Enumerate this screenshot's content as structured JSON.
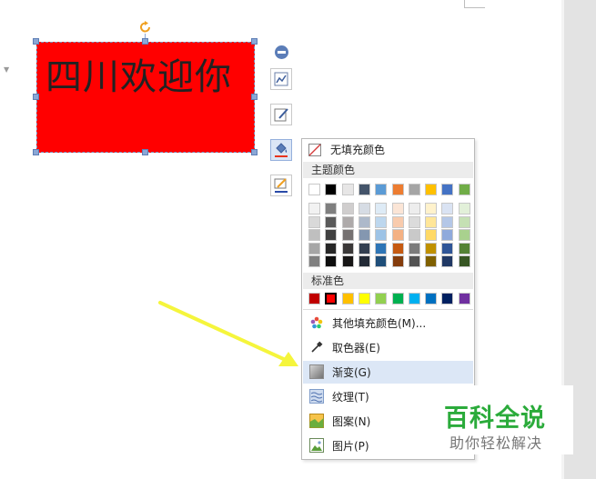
{
  "textbox": {
    "text": "四川欢迎你",
    "fill": "#ff0000"
  },
  "side_tools": [
    {
      "name": "collapse",
      "icon": "minus-circle-icon"
    },
    {
      "name": "chart-layout",
      "icon": "chart-icon"
    },
    {
      "name": "edit-shape",
      "icon": "shape-edit-icon"
    },
    {
      "name": "fill",
      "icon": "paint-bucket-icon"
    },
    {
      "name": "outline",
      "icon": "outline-pen-icon"
    }
  ],
  "fill_menu": {
    "no_fill": "无填充颜色",
    "theme_colors_title": "主题颜色",
    "theme_top_row": [
      "#ffffff",
      "#000000",
      "#e7e6e6",
      "#44546a",
      "#5b9bd5",
      "#ed7d31",
      "#a5a5a5",
      "#ffc000",
      "#4472c4",
      "#70ad47"
    ],
    "theme_shades": [
      [
        "#f2f2f2",
        "#7f7f7f",
        "#d0cece",
        "#d6dce4",
        "#deebf6",
        "#fbe5d6",
        "#ededed",
        "#fff2cc",
        "#dae3f3",
        "#e2f0d9"
      ],
      [
        "#d9d9d9",
        "#595959",
        "#aeaaaa",
        "#adb9ca",
        "#bdd7ee",
        "#f8cbad",
        "#dbdbdb",
        "#ffe699",
        "#b4c7e7",
        "#c5e0b4"
      ],
      [
        "#bfbfbf",
        "#404040",
        "#757171",
        "#8497b0",
        "#9dc3e6",
        "#f4b183",
        "#c9c9c9",
        "#ffd966",
        "#8faadc",
        "#a9d18e"
      ],
      [
        "#a6a6a6",
        "#262626",
        "#3a3838",
        "#333f50",
        "#2e75b6",
        "#c55a11",
        "#7b7b7b",
        "#bf9000",
        "#2f5597",
        "#548235"
      ],
      [
        "#808080",
        "#0d0d0d",
        "#171616",
        "#222a35",
        "#1f4e79",
        "#843c0c",
        "#525252",
        "#7f6000",
        "#203864",
        "#375623"
      ]
    ],
    "standard_colors_title": "标准色",
    "standard_colors": [
      "#c00000",
      "#ff0000",
      "#ffc000",
      "#ffff00",
      "#92d050",
      "#00b050",
      "#00b0f0",
      "#0070c0",
      "#002060",
      "#7030a0"
    ],
    "selected_standard_color": "#ff0000",
    "items": [
      {
        "label": "其他填充颜色(M)...",
        "icon": "color-wheel-icon"
      },
      {
        "label": "取色器(E)",
        "icon": "eyedropper-icon"
      },
      {
        "label": "渐变(G)",
        "icon": "gradient-icon"
      },
      {
        "label": "纹理(T)",
        "icon": "texture-icon"
      },
      {
        "label": "图案(N)",
        "icon": "pattern-icon"
      },
      {
        "label": "图片(P)",
        "icon": "picture-icon"
      }
    ],
    "hovered_item": "渐变(G)"
  },
  "annotation_arrow_color": "#f5f53c",
  "watermark": {
    "title": "百科全说",
    "subtitle": "助你轻松解决"
  }
}
